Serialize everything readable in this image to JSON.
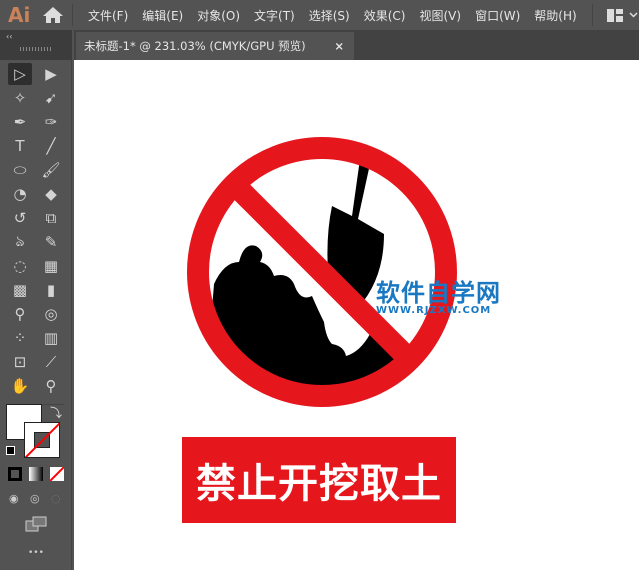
{
  "app": {
    "logo": "Ai"
  },
  "menu": [
    "文件(F)",
    "编辑(E)",
    "对象(O)",
    "文字(T)",
    "选择(S)",
    "效果(C)",
    "视图(V)",
    "窗口(W)",
    "帮助(H)"
  ],
  "tab": {
    "title": "未标题-1* @ 231.03% (CMYK/GPU 预览)",
    "close": "×"
  },
  "panel": {
    "collapse": "‹‹"
  },
  "tools": [
    {
      "name": "selection-tool",
      "glyph": "▷"
    },
    {
      "name": "direct-selection-tool",
      "glyph": "▶"
    },
    {
      "name": "magic-wand-tool",
      "glyph": "✧"
    },
    {
      "name": "lasso-tool",
      "glyph": "➹"
    },
    {
      "name": "pen-tool",
      "glyph": "✒"
    },
    {
      "name": "curvature-tool",
      "glyph": "✑"
    },
    {
      "name": "type-tool",
      "glyph": "T"
    },
    {
      "name": "line-tool",
      "glyph": "╱"
    },
    {
      "name": "ellipse-tool",
      "glyph": "⬭"
    },
    {
      "name": "paintbrush-tool",
      "glyph": "🖌"
    },
    {
      "name": "shaper-tool",
      "glyph": "◔"
    },
    {
      "name": "eraser-tool",
      "glyph": "◆"
    },
    {
      "name": "rotate-tool",
      "glyph": "↺"
    },
    {
      "name": "scale-tool",
      "glyph": "⧉"
    },
    {
      "name": "warp-tool",
      "glyph": "ঌ"
    },
    {
      "name": "puppet-warp-tool",
      "glyph": "✎"
    },
    {
      "name": "shape-builder-tool",
      "glyph": "◌"
    },
    {
      "name": "perspective-grid-tool",
      "glyph": "▦"
    },
    {
      "name": "mesh-tool",
      "glyph": "▩"
    },
    {
      "name": "gradient-tool",
      "glyph": "▮"
    },
    {
      "name": "eyedropper-tool",
      "glyph": "⚲"
    },
    {
      "name": "blend-tool",
      "glyph": "◎"
    },
    {
      "name": "symbol-sprayer-tool",
      "glyph": "⁘"
    },
    {
      "name": "column-graph-tool",
      "glyph": "▥"
    },
    {
      "name": "artboard-tool",
      "glyph": "⊡"
    },
    {
      "name": "slice-tool",
      "glyph": "⟋"
    },
    {
      "name": "hand-tool",
      "glyph": "✋"
    },
    {
      "name": "zoom-tool",
      "glyph": "⚲"
    }
  ],
  "more": "•••",
  "sign": {
    "text": "禁止开挖取土",
    "red": "#e6161d"
  },
  "watermark": {
    "title": "软件自学网",
    "url": "WWW.RJZXW.COM",
    "color": "#1a78c2"
  }
}
